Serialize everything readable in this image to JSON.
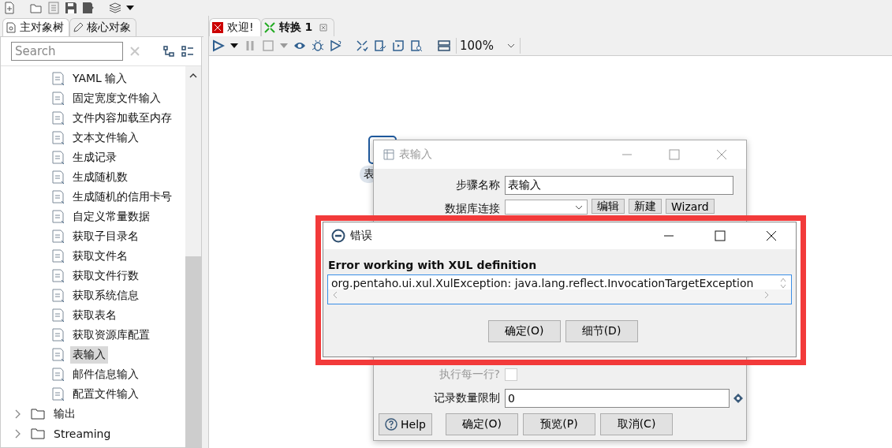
{
  "left_panel": {
    "tabs": [
      {
        "label": "主对象树",
        "selected": true
      },
      {
        "label": "核心对象",
        "selected": false
      }
    ],
    "search": {
      "placeholder": "Search"
    },
    "tree": [
      {
        "label": "YAML 输入",
        "kind": "step",
        "selected": false
      },
      {
        "label": "固定宽度文件输入",
        "kind": "step",
        "selected": false
      },
      {
        "label": "文件内容加载至内存",
        "kind": "step",
        "selected": false
      },
      {
        "label": "文本文件输入",
        "kind": "step",
        "selected": false
      },
      {
        "label": "生成记录",
        "kind": "step",
        "selected": false
      },
      {
        "label": "生成随机数",
        "kind": "step",
        "selected": false
      },
      {
        "label": "生成随机的信用卡号",
        "kind": "step",
        "selected": false
      },
      {
        "label": "自定义常量数据",
        "kind": "step",
        "selected": false
      },
      {
        "label": "获取子目录名",
        "kind": "step",
        "selected": false
      },
      {
        "label": "获取文件名",
        "kind": "step",
        "selected": false
      },
      {
        "label": "获取文件行数",
        "kind": "step",
        "selected": false
      },
      {
        "label": "获取系统信息",
        "kind": "step",
        "selected": false
      },
      {
        "label": "获取表名",
        "kind": "step",
        "selected": false
      },
      {
        "label": "获取资源库配置",
        "kind": "step",
        "selected": false
      },
      {
        "label": "表输入",
        "kind": "step",
        "selected": true
      },
      {
        "label": "邮件信息输入",
        "kind": "step",
        "selected": false
      },
      {
        "label": "配置文件输入",
        "kind": "step",
        "selected": false
      },
      {
        "label": "输出",
        "kind": "folder",
        "expanded": false
      },
      {
        "label": "Streaming",
        "kind": "folder",
        "expanded": false
      }
    ]
  },
  "editor_tabs": [
    {
      "label": "欢迎!",
      "selected": false,
      "closable": false
    },
    {
      "label": "转换 1",
      "selected": true,
      "closable": true
    }
  ],
  "zoom": {
    "value": "100%"
  },
  "canvas": {
    "step": {
      "label": "表"
    }
  },
  "step_dialog": {
    "title": "表输入",
    "fields_top": [
      {
        "label": "步骤名称",
        "kind": "text",
        "value": "表输入"
      },
      {
        "label": "数据库连接",
        "kind": "combo",
        "buttons": [
          "编辑",
          "新建",
          "Wizard"
        ]
      }
    ],
    "fields_bottom": [
      {
        "label": "执行每一行?",
        "kind": "checkbox",
        "checked": false,
        "disabled": true
      },
      {
        "label": "记录数量限制",
        "kind": "text",
        "value": "0",
        "variable": true
      }
    ],
    "buttons": [
      {
        "label": "Help",
        "kind": "help"
      },
      {
        "label": "确定(O)",
        "kind": "plain"
      },
      {
        "label": "预览(P)",
        "kind": "plain"
      },
      {
        "label": "取消(C)",
        "kind": "plain"
      }
    ]
  },
  "error_dialog": {
    "title": "错误",
    "heading": "Error working with XUL definition",
    "detail": "org.pentaho.ui.xul.XulException: java.lang.reflect.InvocationTargetException",
    "buttons": [
      "确定(O)",
      "细节(D)"
    ]
  }
}
